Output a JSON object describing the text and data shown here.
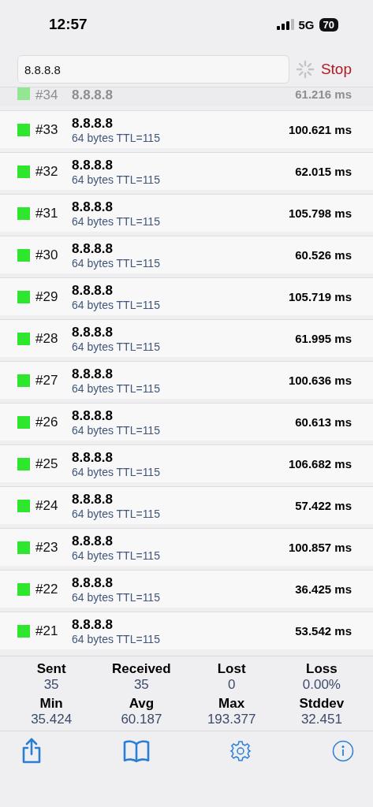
{
  "status_bar": {
    "time": "12:57",
    "network": "5G",
    "battery": "70"
  },
  "search": {
    "value": "8.8.8.8",
    "loading": true,
    "button": "Stop"
  },
  "pings": [
    {
      "number": "#34",
      "host": "8.8.8.8",
      "time": "61.216 ms",
      "color": "#93e693",
      "dimmed": true
    },
    {
      "number": "#33",
      "host": "8.8.8.8",
      "detail": "64 bytes TTL=115",
      "time": "100.621 ms",
      "color": "#2ee62e",
      "dimmed": false
    },
    {
      "number": "#32",
      "host": "8.8.8.8",
      "detail": "64 bytes TTL=115",
      "time": "62.015 ms",
      "color": "#2ee62e",
      "dimmed": false
    },
    {
      "number": "#31",
      "host": "8.8.8.8",
      "detail": "64 bytes TTL=115",
      "time": "105.798 ms",
      "color": "#2ee62e",
      "dimmed": false
    },
    {
      "number": "#30",
      "host": "8.8.8.8",
      "detail": "64 bytes TTL=115",
      "time": "60.526 ms",
      "color": "#2ee62e",
      "dimmed": false
    },
    {
      "number": "#29",
      "host": "8.8.8.8",
      "detail": "64 bytes TTL=115",
      "time": "105.719 ms",
      "color": "#2ee62e",
      "dimmed": false
    },
    {
      "number": "#28",
      "host": "8.8.8.8",
      "detail": "64 bytes TTL=115",
      "time": "61.995 ms",
      "color": "#2ee62e",
      "dimmed": false
    },
    {
      "number": "#27",
      "host": "8.8.8.8",
      "detail": "64 bytes TTL=115",
      "time": "100.636 ms",
      "color": "#2ee62e",
      "dimmed": false
    },
    {
      "number": "#26",
      "host": "8.8.8.8",
      "detail": "64 bytes TTL=115",
      "time": "60.613 ms",
      "color": "#2ee62e",
      "dimmed": false
    },
    {
      "number": "#25",
      "host": "8.8.8.8",
      "detail": "64 bytes TTL=115",
      "time": "106.682 ms",
      "color": "#2ee62e",
      "dimmed": false
    },
    {
      "number": "#24",
      "host": "8.8.8.8",
      "detail": "64 bytes TTL=115",
      "time": "57.422 ms",
      "color": "#2ee62e",
      "dimmed": false
    },
    {
      "number": "#23",
      "host": "8.8.8.8",
      "detail": "64 bytes TTL=115",
      "time": "100.857 ms",
      "color": "#2ee62e",
      "dimmed": false
    },
    {
      "number": "#22",
      "host": "8.8.8.8",
      "detail": "64 bytes TTL=115",
      "time": "36.425 ms",
      "color": "#2ee62e",
      "dimmed": false
    },
    {
      "number": "#21",
      "host": "8.8.8.8",
      "detail": "64 bytes TTL=115",
      "time": "53.542 ms",
      "color": "#2ee62e",
      "dimmed": false
    }
  ],
  "stats": [
    {
      "label": "Sent",
      "value": "35"
    },
    {
      "label": "Received",
      "value": "35"
    },
    {
      "label": "Lost",
      "value": "0"
    },
    {
      "label": "Loss",
      "value": "0.00%"
    },
    {
      "label": "Min",
      "value": "35.424"
    },
    {
      "label": "Avg",
      "value": "60.187"
    },
    {
      "label": "Max",
      "value": "193.377"
    },
    {
      "label": "Stddev",
      "value": "32.451"
    }
  ],
  "toolbar": [
    {
      "kind": "share"
    },
    {
      "kind": "book"
    },
    {
      "kind": "settings"
    },
    {
      "kind": "info"
    }
  ]
}
